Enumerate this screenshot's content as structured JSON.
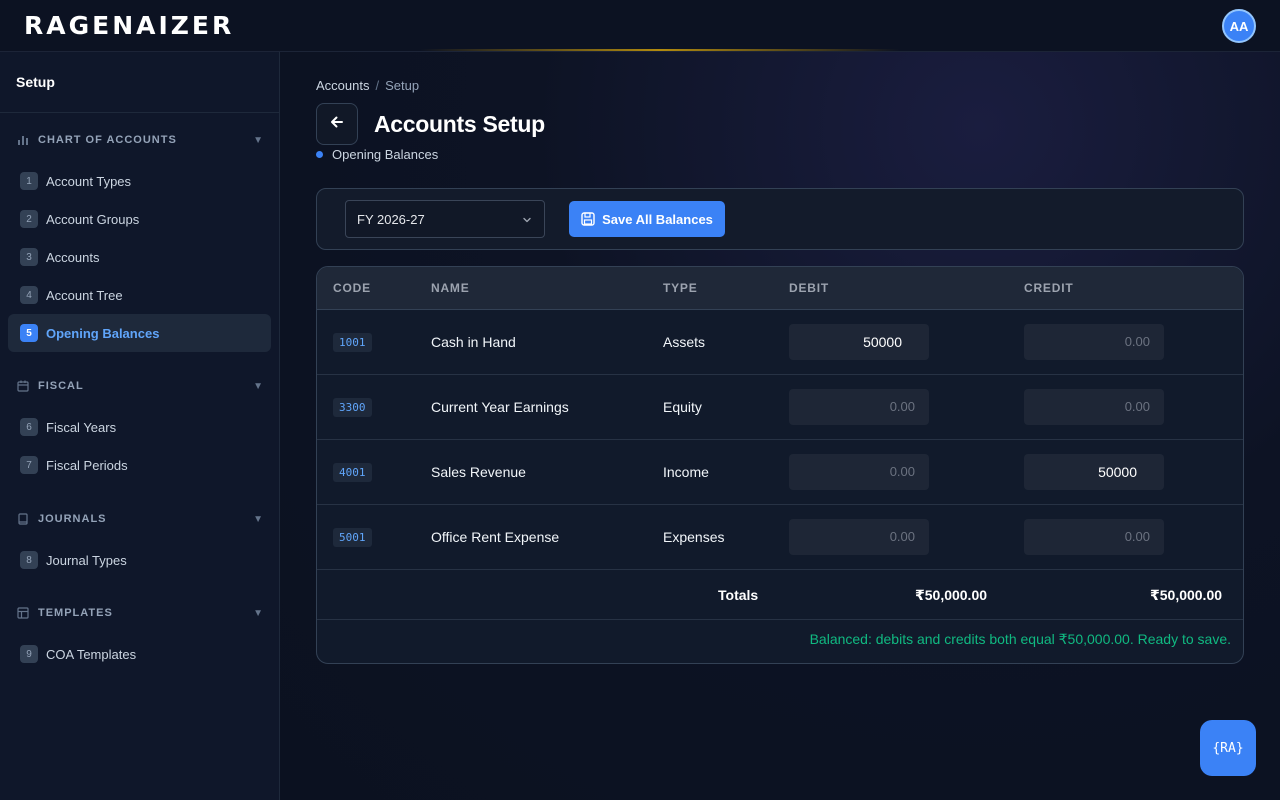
{
  "app": {
    "logo": "RAGENAIZER",
    "avatar_initials": "AA",
    "accent_color": "#3b82f6",
    "success_color": "#10b981"
  },
  "sidebar": {
    "title": "Setup",
    "sections": [
      {
        "title": "CHART OF ACCOUNTS",
        "icon": "bar-chart-icon",
        "items": [
          {
            "num": "1",
            "label": "Account Types"
          },
          {
            "num": "2",
            "label": "Account Groups"
          },
          {
            "num": "3",
            "label": "Accounts"
          },
          {
            "num": "4",
            "label": "Account Tree"
          },
          {
            "num": "5",
            "label": "Opening Balances",
            "active": true
          }
        ]
      },
      {
        "title": "FISCAL",
        "icon": "calendar-icon",
        "items": [
          {
            "num": "6",
            "label": "Fiscal Years"
          },
          {
            "num": "7",
            "label": "Fiscal Periods"
          }
        ]
      },
      {
        "title": "JOURNALS",
        "icon": "book-icon",
        "items": [
          {
            "num": "8",
            "label": "Journal Types"
          }
        ]
      },
      {
        "title": "TEMPLATES",
        "icon": "layout-icon",
        "items": [
          {
            "num": "9",
            "label": "COA Templates"
          }
        ]
      }
    ]
  },
  "breadcrumb": {
    "items": [
      "Accounts",
      "Setup"
    ],
    "separator": "/"
  },
  "page": {
    "title": "Accounts Setup",
    "subtitle": "Opening Balances"
  },
  "toolbar": {
    "fiscal_year": "FY 2026-27",
    "save_label": "Save All Balances"
  },
  "table": {
    "columns": [
      "CODE",
      "NAME",
      "TYPE",
      "DEBIT",
      "CREDIT"
    ],
    "placeholder": "0.00",
    "rows": [
      {
        "code": "1001",
        "name": "Cash in Hand",
        "type": "Assets",
        "debit": "50000",
        "credit": ""
      },
      {
        "code": "3300",
        "name": "Current Year Earnings",
        "type": "Equity",
        "debit": "",
        "credit": ""
      },
      {
        "code": "4001",
        "name": "Sales Revenue",
        "type": "Income",
        "debit": "",
        "credit": "50000"
      },
      {
        "code": "5001",
        "name": "Office Rent Expense",
        "type": "Expenses",
        "debit": "",
        "credit": ""
      }
    ],
    "totals": {
      "label": "Totals",
      "debit": "₹50,000.00",
      "credit": "₹50,000.00"
    },
    "status": "Balanced: debits and credits both equal ₹50,000.00. Ready to save."
  },
  "fab": {
    "label": "{RA}",
    "icon": "assistant-icon"
  }
}
